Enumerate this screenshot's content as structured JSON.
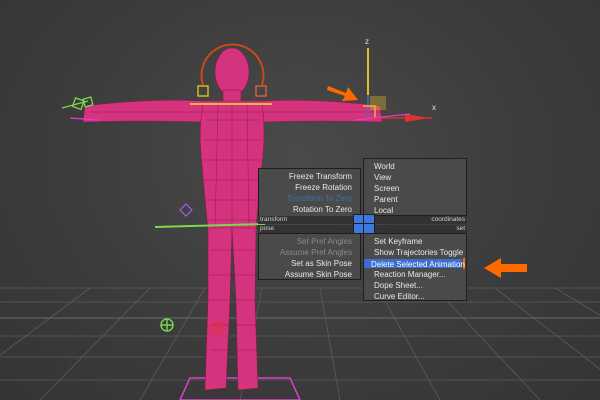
{
  "colors": {
    "background": "#3a3a3a",
    "grid": "#5a5a5a",
    "character": "#d6337f",
    "menu_bg": "#4a4a4a",
    "menu_highlight": "#3b6ed0",
    "callout_arrow": "#ff6a00",
    "ik_helper": "#7bd94a",
    "selected_gizmo": "#e0c020"
  },
  "gizmo": {
    "z_label": "z",
    "x_label": "x"
  },
  "quad_menu": {
    "transform": {
      "header": "transform",
      "items": [
        {
          "label": "Freeze Transform",
          "state": "normal"
        },
        {
          "label": "Freeze Rotation",
          "state": "normal"
        },
        {
          "label": "Transform To Zero",
          "state": "normal-blue"
        },
        {
          "label": "Rotation To Zero",
          "state": "normal"
        }
      ]
    },
    "coordinates": {
      "header": "coordinates",
      "items": [
        "World",
        "View",
        "Screen",
        "Parent",
        "Local"
      ]
    },
    "pose": {
      "header": "pose",
      "items": [
        {
          "label": "Set Pref Angles",
          "state": "disabled"
        },
        {
          "label": "Assume Pref Angles",
          "state": "disabled"
        },
        {
          "label": "Set as Skin Pose",
          "state": "normal"
        },
        {
          "label": "Assume Skin Pose",
          "state": "normal"
        }
      ]
    },
    "set": {
      "header": "set",
      "items": [
        "Set Keyframe",
        "Show Trajectories Toggle",
        "Delete Selected Animation",
        "Reaction Manager...",
        "Dope Sheet...",
        "Curve Editor..."
      ],
      "highlighted_index": 2
    }
  },
  "icons": {
    "callout_arrow": "orange-arrow-icon",
    "center_quad_marker": "quad-center-icon"
  }
}
